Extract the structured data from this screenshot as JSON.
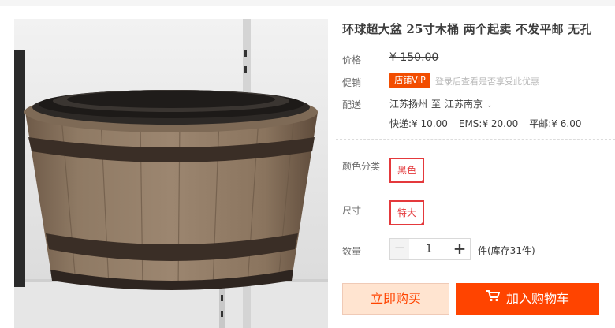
{
  "product": {
    "title": "环球超大盆 25寸木桶 两个起卖 不发平邮 无孔",
    "image_alt": "wooden barrel planter"
  },
  "price": {
    "label": "价格",
    "value": "¥ 150.00"
  },
  "promo": {
    "label": "促销",
    "badge": "店铺VIP",
    "note": "登录后查看是否享受此优惠"
  },
  "shipping": {
    "label": "配送",
    "from": "江苏扬州",
    "sep": "至",
    "to": "江苏南京",
    "express": "快递:¥ 10.00",
    "ems": "EMS:¥ 20.00",
    "mail": "平邮:¥ 6.00"
  },
  "options": {
    "color_label": "颜色分类",
    "color_value": "黑色",
    "size_label": "尺寸",
    "size_value": "特大"
  },
  "quantity": {
    "label": "数量",
    "minus": "−",
    "value": "1",
    "plus": "+",
    "stock": "件(库存31件)"
  },
  "actions": {
    "buy_now": "立即购买",
    "add_to_cart": "加入购物车"
  },
  "colors": {
    "accent": "#ff4400",
    "selected_border": "#e4393c"
  }
}
